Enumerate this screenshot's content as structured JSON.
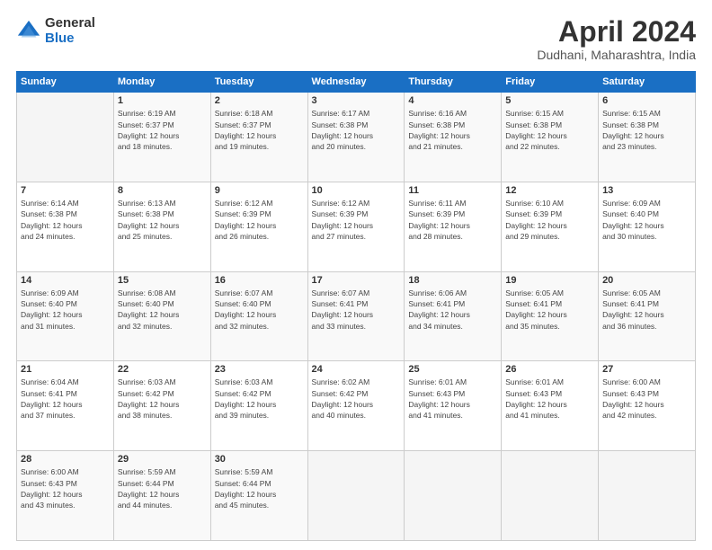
{
  "header": {
    "logo_general": "General",
    "logo_blue": "Blue",
    "month_title": "April 2024",
    "location": "Dudhani, Maharashtra, India"
  },
  "days_of_week": [
    "Sunday",
    "Monday",
    "Tuesday",
    "Wednesday",
    "Thursday",
    "Friday",
    "Saturday"
  ],
  "weeks": [
    [
      {
        "day": "",
        "info": ""
      },
      {
        "day": "1",
        "info": "Sunrise: 6:19 AM\nSunset: 6:37 PM\nDaylight: 12 hours\nand 18 minutes."
      },
      {
        "day": "2",
        "info": "Sunrise: 6:18 AM\nSunset: 6:37 PM\nDaylight: 12 hours\nand 19 minutes."
      },
      {
        "day": "3",
        "info": "Sunrise: 6:17 AM\nSunset: 6:38 PM\nDaylight: 12 hours\nand 20 minutes."
      },
      {
        "day": "4",
        "info": "Sunrise: 6:16 AM\nSunset: 6:38 PM\nDaylight: 12 hours\nand 21 minutes."
      },
      {
        "day": "5",
        "info": "Sunrise: 6:15 AM\nSunset: 6:38 PM\nDaylight: 12 hours\nand 22 minutes."
      },
      {
        "day": "6",
        "info": "Sunrise: 6:15 AM\nSunset: 6:38 PM\nDaylight: 12 hours\nand 23 minutes."
      }
    ],
    [
      {
        "day": "7",
        "info": "Sunrise: 6:14 AM\nSunset: 6:38 PM\nDaylight: 12 hours\nand 24 minutes."
      },
      {
        "day": "8",
        "info": "Sunrise: 6:13 AM\nSunset: 6:38 PM\nDaylight: 12 hours\nand 25 minutes."
      },
      {
        "day": "9",
        "info": "Sunrise: 6:12 AM\nSunset: 6:39 PM\nDaylight: 12 hours\nand 26 minutes."
      },
      {
        "day": "10",
        "info": "Sunrise: 6:12 AM\nSunset: 6:39 PM\nDaylight: 12 hours\nand 27 minutes."
      },
      {
        "day": "11",
        "info": "Sunrise: 6:11 AM\nSunset: 6:39 PM\nDaylight: 12 hours\nand 28 minutes."
      },
      {
        "day": "12",
        "info": "Sunrise: 6:10 AM\nSunset: 6:39 PM\nDaylight: 12 hours\nand 29 minutes."
      },
      {
        "day": "13",
        "info": "Sunrise: 6:09 AM\nSunset: 6:40 PM\nDaylight: 12 hours\nand 30 minutes."
      }
    ],
    [
      {
        "day": "14",
        "info": "Sunrise: 6:09 AM\nSunset: 6:40 PM\nDaylight: 12 hours\nand 31 minutes."
      },
      {
        "day": "15",
        "info": "Sunrise: 6:08 AM\nSunset: 6:40 PM\nDaylight: 12 hours\nand 32 minutes."
      },
      {
        "day": "16",
        "info": "Sunrise: 6:07 AM\nSunset: 6:40 PM\nDaylight: 12 hours\nand 32 minutes."
      },
      {
        "day": "17",
        "info": "Sunrise: 6:07 AM\nSunset: 6:41 PM\nDaylight: 12 hours\nand 33 minutes."
      },
      {
        "day": "18",
        "info": "Sunrise: 6:06 AM\nSunset: 6:41 PM\nDaylight: 12 hours\nand 34 minutes."
      },
      {
        "day": "19",
        "info": "Sunrise: 6:05 AM\nSunset: 6:41 PM\nDaylight: 12 hours\nand 35 minutes."
      },
      {
        "day": "20",
        "info": "Sunrise: 6:05 AM\nSunset: 6:41 PM\nDaylight: 12 hours\nand 36 minutes."
      }
    ],
    [
      {
        "day": "21",
        "info": "Sunrise: 6:04 AM\nSunset: 6:41 PM\nDaylight: 12 hours\nand 37 minutes."
      },
      {
        "day": "22",
        "info": "Sunrise: 6:03 AM\nSunset: 6:42 PM\nDaylight: 12 hours\nand 38 minutes."
      },
      {
        "day": "23",
        "info": "Sunrise: 6:03 AM\nSunset: 6:42 PM\nDaylight: 12 hours\nand 39 minutes."
      },
      {
        "day": "24",
        "info": "Sunrise: 6:02 AM\nSunset: 6:42 PM\nDaylight: 12 hours\nand 40 minutes."
      },
      {
        "day": "25",
        "info": "Sunrise: 6:01 AM\nSunset: 6:43 PM\nDaylight: 12 hours\nand 41 minutes."
      },
      {
        "day": "26",
        "info": "Sunrise: 6:01 AM\nSunset: 6:43 PM\nDaylight: 12 hours\nand 41 minutes."
      },
      {
        "day": "27",
        "info": "Sunrise: 6:00 AM\nSunset: 6:43 PM\nDaylight: 12 hours\nand 42 minutes."
      }
    ],
    [
      {
        "day": "28",
        "info": "Sunrise: 6:00 AM\nSunset: 6:43 PM\nDaylight: 12 hours\nand 43 minutes."
      },
      {
        "day": "29",
        "info": "Sunrise: 5:59 AM\nSunset: 6:44 PM\nDaylight: 12 hours\nand 44 minutes."
      },
      {
        "day": "30",
        "info": "Sunrise: 5:59 AM\nSunset: 6:44 PM\nDaylight: 12 hours\nand 45 minutes."
      },
      {
        "day": "",
        "info": ""
      },
      {
        "day": "",
        "info": ""
      },
      {
        "day": "",
        "info": ""
      },
      {
        "day": "",
        "info": ""
      }
    ]
  ]
}
